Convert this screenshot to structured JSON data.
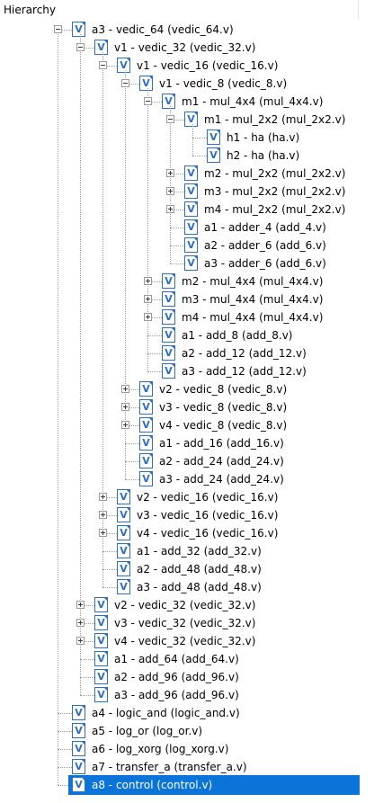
{
  "panel": {
    "title": "Hierarchy"
  },
  "tree": [
    {
      "d": 0,
      "exp": "minus",
      "label": "a3 - vedic_64 (vedic_64.v)"
    },
    {
      "d": 1,
      "exp": "minus",
      "label": "v1 - vedic_32 (vedic_32.v)"
    },
    {
      "d": 2,
      "exp": "minus",
      "label": "v1 - vedic_16 (vedic_16.v)"
    },
    {
      "d": 3,
      "exp": "minus",
      "label": "v1 - vedic_8 (vedic_8.v)"
    },
    {
      "d": 4,
      "exp": "minus",
      "label": "m1 - mul_4x4 (mul_4x4.v)"
    },
    {
      "d": 5,
      "exp": "minus",
      "label": "m1 - mul_2x2 (mul_2x2.v)"
    },
    {
      "d": 6,
      "exp": "none",
      "label": "h1 - ha (ha.v)"
    },
    {
      "d": 6,
      "exp": "none",
      "label": "h2 - ha (ha.v)"
    },
    {
      "d": 5,
      "exp": "plus",
      "label": "m2 - mul_2x2 (mul_2x2.v)"
    },
    {
      "d": 5,
      "exp": "plus",
      "label": "m3 - mul_2x2 (mul_2x2.v)"
    },
    {
      "d": 5,
      "exp": "plus",
      "label": "m4 - mul_2x2 (mul_2x2.v)"
    },
    {
      "d": 5,
      "exp": "none",
      "label": "a1 - adder_4 (add_4.v)"
    },
    {
      "d": 5,
      "exp": "none",
      "label": "a2 - adder_6 (add_6.v)"
    },
    {
      "d": 5,
      "exp": "none",
      "label": "a3 - adder_6 (add_6.v)"
    },
    {
      "d": 4,
      "exp": "plus",
      "label": "m2 - mul_4x4 (mul_4x4.v)"
    },
    {
      "d": 4,
      "exp": "plus",
      "label": "m3 - mul_4x4 (mul_4x4.v)"
    },
    {
      "d": 4,
      "exp": "plus",
      "label": "m4 - mul_4x4 (mul_4x4.v)"
    },
    {
      "d": 4,
      "exp": "none",
      "label": "a1 - add_8 (add_8.v)"
    },
    {
      "d": 4,
      "exp": "none",
      "label": "a2 - add_12 (add_12.v)"
    },
    {
      "d": 4,
      "exp": "none",
      "label": "a3 - add_12 (add_12.v)"
    },
    {
      "d": 3,
      "exp": "plus",
      "label": "v2 - vedic_8 (vedic_8.v)"
    },
    {
      "d": 3,
      "exp": "plus",
      "label": "v3 - vedic_8 (vedic_8.v)"
    },
    {
      "d": 3,
      "exp": "plus",
      "label": "v4 - vedic_8 (vedic_8.v)"
    },
    {
      "d": 3,
      "exp": "none",
      "label": "a1 - add_16 (add_16.v)"
    },
    {
      "d": 3,
      "exp": "none",
      "label": "a2 - add_24 (add_24.v)"
    },
    {
      "d": 3,
      "exp": "none",
      "label": "a3 - add_24 (add_24.v)"
    },
    {
      "d": 2,
      "exp": "plus",
      "label": "v2 - vedic_16 (vedic_16.v)"
    },
    {
      "d": 2,
      "exp": "plus",
      "label": "v3 - vedic_16 (vedic_16.v)"
    },
    {
      "d": 2,
      "exp": "plus",
      "label": "v4 - vedic_16 (vedic_16.v)"
    },
    {
      "d": 2,
      "exp": "none",
      "label": "a1 - add_32 (add_32.v)"
    },
    {
      "d": 2,
      "exp": "none",
      "label": "a2 - add_48 (add_48.v)"
    },
    {
      "d": 2,
      "exp": "none",
      "label": "a3 - add_48 (add_48.v)"
    },
    {
      "d": 1,
      "exp": "plus",
      "label": "v2 - vedic_32 (vedic_32.v)"
    },
    {
      "d": 1,
      "exp": "plus",
      "label": "v3 - vedic_32 (vedic_32.v)"
    },
    {
      "d": 1,
      "exp": "plus",
      "label": "v4 - vedic_32 (vedic_32.v)"
    },
    {
      "d": 1,
      "exp": "none",
      "label": "a1 - add_64 (add_64.v)"
    },
    {
      "d": 1,
      "exp": "none",
      "label": "a2 - add_96 (add_96.v)"
    },
    {
      "d": 1,
      "exp": "none",
      "label": "a3 - add_96 (add_96.v)"
    },
    {
      "d": 0,
      "exp": "none",
      "label": "a4 - logic_and (logic_and.v)"
    },
    {
      "d": 0,
      "exp": "none",
      "label": "a5 - log_or (log_or.v)"
    },
    {
      "d": 0,
      "exp": "none",
      "label": "a6 - log_xorg (log_xorg.v)"
    },
    {
      "d": 0,
      "exp": "none",
      "label": "a7 - transfer_a (transfer_a.v)"
    },
    {
      "d": 0,
      "exp": "none",
      "label": "a8 - control (control.v)",
      "selected": true
    }
  ],
  "icon_glyph": "V",
  "colors": {
    "selection": "#0a74d9",
    "icon": "#2f6fbf"
  }
}
